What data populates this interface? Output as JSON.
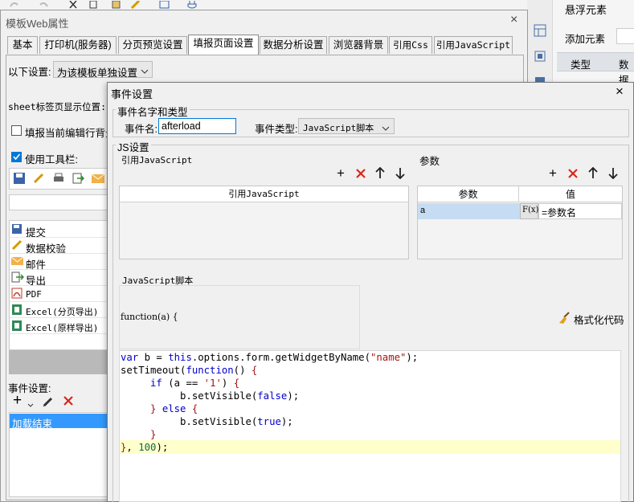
{
  "outer": {
    "title": "模板Web属性",
    "close": "×",
    "tabs": [
      "基本",
      "打印机(服务器)",
      "分页预览设置",
      "填报页面设置",
      "数据分析设置",
      "浏览器背景",
      "引用Css",
      "引用JavaScript"
    ],
    "settings_label": "以下设置:",
    "settings_value": "为该模板单独设置",
    "sheet_label": "sheet标签页显示位置:",
    "highlight_label": "填报当前编辑行背景",
    "highlight_checked": false,
    "toolbar_label": "使用工具栏:",
    "toolbar_checked": true,
    "button_list": [
      "提交",
      "数据校验",
      "邮件",
      "导出",
      "PDF",
      "Excel(分页导出)",
      "Excel(原样导出)"
    ],
    "event_label": "事件设置:",
    "event_items": [
      "加载结束"
    ]
  },
  "right_panel": {
    "title": "悬浮元素",
    "add_label": "添加元素",
    "col_type": "类型",
    "col_data": "数据"
  },
  "dialog": {
    "title": "事件设置",
    "close": "×",
    "name_group": "事件名字和类型",
    "name_label": "事件名:",
    "name_value": "afterload",
    "type_label": "事件类型:",
    "type_value": "JavaScript脚本",
    "js_group": "JS设置",
    "ref_label": "引用JavaScript",
    "ref_column": "引用JavaScript",
    "params_label": "参数",
    "params_columns": [
      "参数",
      "值"
    ],
    "params_rows": [
      {
        "name": "a",
        "formula_icon": "F(x)",
        "value": "=参数名"
      }
    ],
    "script_label": "JavaScript脚本",
    "function_header": "function(a) {",
    "format_label": "格式化代码"
  },
  "code_lines": [
    "var b = this.options.form.getWidgetByName(\"name\");",
    "setTimeout(function() {",
    "     if (a == '1') {",
    "          b.setVisible(false);",
    "     } else {",
    "          b.setVisible(true);",
    "     }",
    "}, 100);"
  ],
  "colors": {
    "selection": "#3399ff",
    "delete_red": "#d9261c",
    "code_highlight": "#ffffcc",
    "param_row": "#c6dcf2"
  }
}
